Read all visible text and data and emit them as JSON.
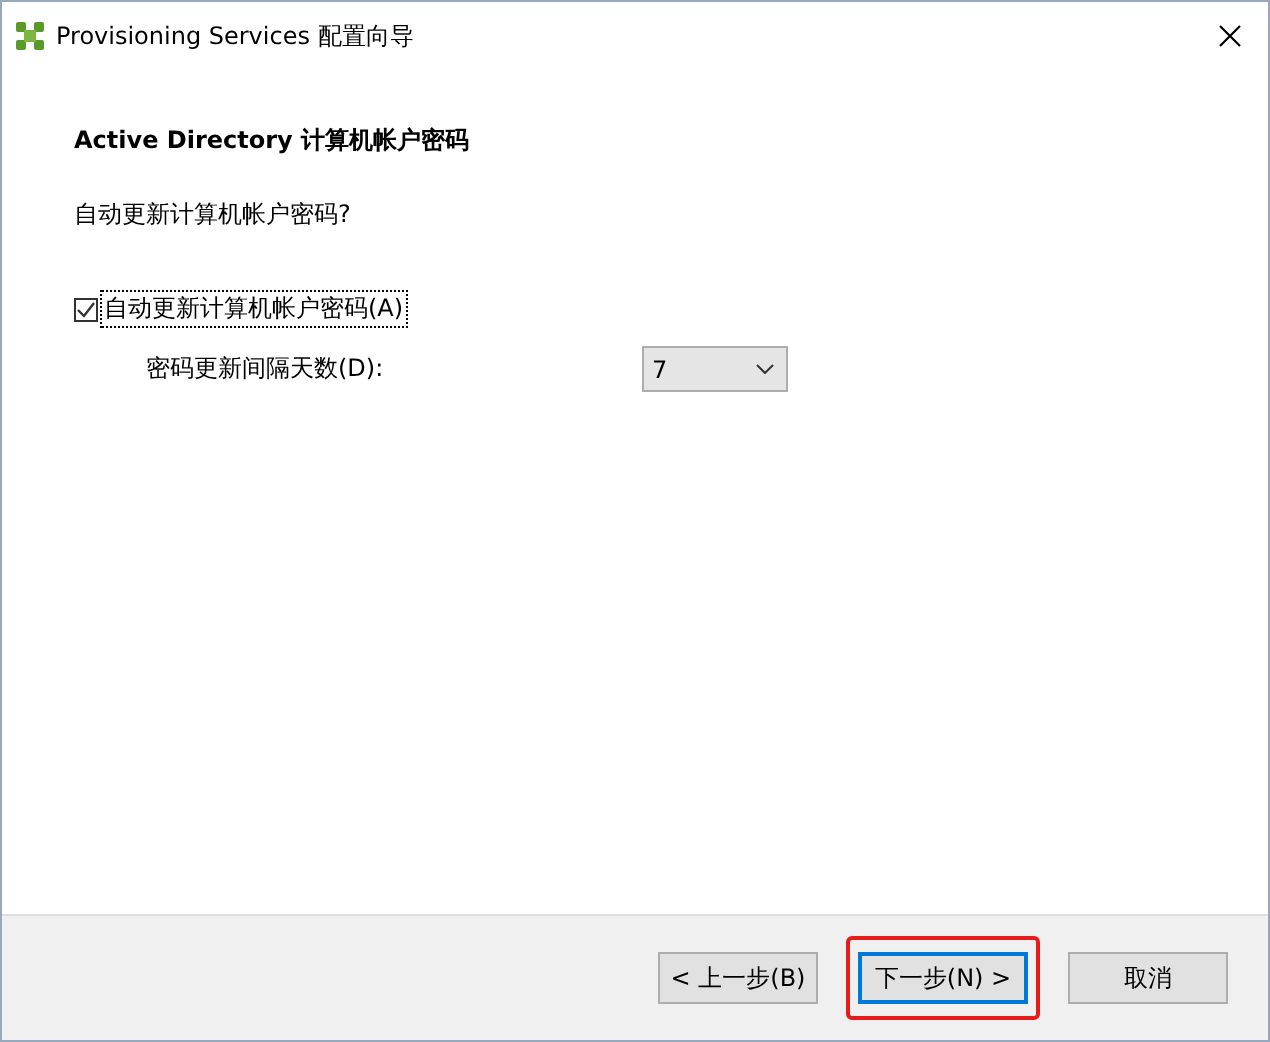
{
  "window": {
    "title": "Provisioning Services 配置向导"
  },
  "heading": "Active Directory 计算机帐户密码",
  "question": "自动更新计算机帐户密码?",
  "auto_update": {
    "label": "自动更新计算机帐户密码(A)",
    "checked": true
  },
  "interval": {
    "label": "密码更新间隔天数(D):",
    "value": "7"
  },
  "buttons": [
    {
      "label": "< 上一步(B)",
      "highlighted": false
    },
    {
      "label": "下一步(N) >",
      "highlighted": true
    },
    {
      "label": "取消",
      "highlighted": false
    }
  ]
}
